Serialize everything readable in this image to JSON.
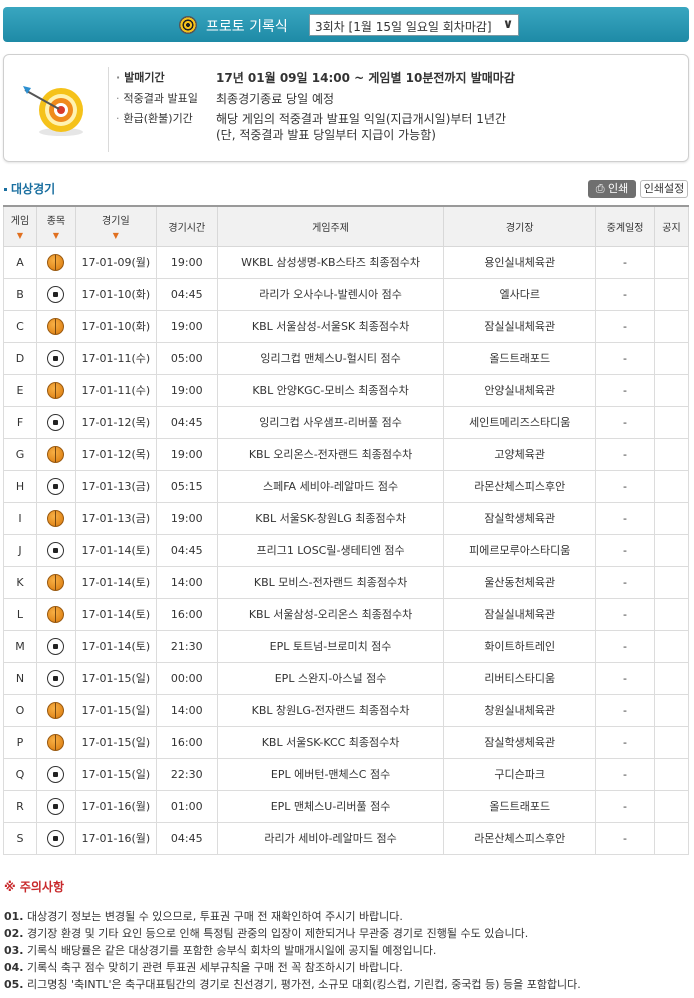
{
  "header": {
    "title": "프로토 기록식",
    "round_select_value": "3회차 [1월 15일 일요일 회차마감]"
  },
  "info": {
    "rows": [
      {
        "label": "발매기간",
        "value": "17년 01월 09일 14:00 ~ 게임별 10분전까지 발매마감"
      },
      {
        "label": "적중결과 발표일",
        "value": "최종경기종료 당일 예정"
      },
      {
        "label": "환급(환불)기간",
        "value": "해당 게임의 적중결과 발표일 익일(지급개시일)부터 1년간"
      }
    ],
    "note": "(단, 적중결과 발표 당일부터 지급이 가능함)"
  },
  "section": {
    "title": "대상경기",
    "print_label": "인쇄",
    "print_settings_label": "인쇄설정"
  },
  "table": {
    "headers": [
      "게임",
      "종목",
      "경기일",
      "경기시간",
      "게임주제",
      "경기장",
      "중계일정",
      "공지"
    ],
    "sortable": [
      true,
      true,
      true,
      false,
      false,
      false,
      false,
      false
    ],
    "rows": [
      {
        "game": "A",
        "sport": "basketball",
        "date": "17-01-09(월)",
        "time": "19:00",
        "subject": "WKBL 삼성생명-KB스타즈 최종점수차",
        "venue": "용인실내체육관",
        "broadcast": "-",
        "notice": ""
      },
      {
        "game": "B",
        "sport": "soccer",
        "date": "17-01-10(화)",
        "time": "04:45",
        "subject": "라리가 오사수나-발렌시아 점수",
        "venue": "엘사다르",
        "broadcast": "-",
        "notice": ""
      },
      {
        "game": "C",
        "sport": "basketball",
        "date": "17-01-10(화)",
        "time": "19:00",
        "subject": "KBL 서울삼성-서울SK 최종점수차",
        "venue": "잠실실내체육관",
        "broadcast": "-",
        "notice": ""
      },
      {
        "game": "D",
        "sport": "soccer",
        "date": "17-01-11(수)",
        "time": "05:00",
        "subject": "잉리그컵 맨체스U-헐시티 점수",
        "venue": "올드트래포드",
        "broadcast": "-",
        "notice": ""
      },
      {
        "game": "E",
        "sport": "basketball",
        "date": "17-01-11(수)",
        "time": "19:00",
        "subject": "KBL 안양KGC-모비스 최종점수차",
        "venue": "안양실내체육관",
        "broadcast": "-",
        "notice": ""
      },
      {
        "game": "F",
        "sport": "soccer",
        "date": "17-01-12(목)",
        "time": "04:45",
        "subject": "잉리그컵 사우샘프-리버풀 점수",
        "venue": "세인트메리즈스타디움",
        "broadcast": "-",
        "notice": ""
      },
      {
        "game": "G",
        "sport": "basketball",
        "date": "17-01-12(목)",
        "time": "19:00",
        "subject": "KBL 오리온스-전자랜드 최종점수차",
        "venue": "고양체육관",
        "broadcast": "-",
        "notice": ""
      },
      {
        "game": "H",
        "sport": "soccer",
        "date": "17-01-13(금)",
        "time": "05:15",
        "subject": "스페FA 세비야-레알마드 점수",
        "venue": "라몬산체스피스후안",
        "broadcast": "-",
        "notice": ""
      },
      {
        "game": "I",
        "sport": "basketball",
        "date": "17-01-13(금)",
        "time": "19:00",
        "subject": "KBL 서울SK-창원LG 최종점수차",
        "venue": "잠실학생체육관",
        "broadcast": "-",
        "notice": ""
      },
      {
        "game": "J",
        "sport": "soccer",
        "date": "17-01-14(토)",
        "time": "04:45",
        "subject": "프리그1 LOSC릴-생테티엔 점수",
        "venue": "피에르모루아스타디움",
        "broadcast": "-",
        "notice": ""
      },
      {
        "game": "K",
        "sport": "basketball",
        "date": "17-01-14(토)",
        "time": "14:00",
        "subject": "KBL 모비스-전자랜드 최종점수차",
        "venue": "울산동천체육관",
        "broadcast": "-",
        "notice": ""
      },
      {
        "game": "L",
        "sport": "basketball",
        "date": "17-01-14(토)",
        "time": "16:00",
        "subject": "KBL 서울삼성-오리온스 최종점수차",
        "venue": "잠실실내체육관",
        "broadcast": "-",
        "notice": ""
      },
      {
        "game": "M",
        "sport": "soccer",
        "date": "17-01-14(토)",
        "time": "21:30",
        "subject": "EPL 토트넘-브로미치 점수",
        "venue": "화이트하트레인",
        "broadcast": "-",
        "notice": ""
      },
      {
        "game": "N",
        "sport": "soccer",
        "date": "17-01-15(일)",
        "time": "00:00",
        "subject": "EPL 스완지-아스널 점수",
        "venue": "리버티스타디움",
        "broadcast": "-",
        "notice": ""
      },
      {
        "game": "O",
        "sport": "basketball",
        "date": "17-01-15(일)",
        "time": "14:00",
        "subject": "KBL 창원LG-전자랜드 최종점수차",
        "venue": "창원실내체육관",
        "broadcast": "-",
        "notice": ""
      },
      {
        "game": "P",
        "sport": "basketball",
        "date": "17-01-15(일)",
        "time": "16:00",
        "subject": "KBL 서울SK-KCC 최종점수차",
        "venue": "잠실학생체육관",
        "broadcast": "-",
        "notice": ""
      },
      {
        "game": "Q",
        "sport": "soccer",
        "date": "17-01-15(일)",
        "time": "22:30",
        "subject": "EPL 에버턴-맨체스C 점수",
        "venue": "구디슨파크",
        "broadcast": "-",
        "notice": ""
      },
      {
        "game": "R",
        "sport": "soccer",
        "date": "17-01-16(월)",
        "time": "01:00",
        "subject": "EPL 맨체스U-리버풀 점수",
        "venue": "올드트래포드",
        "broadcast": "-",
        "notice": ""
      },
      {
        "game": "S",
        "sport": "soccer",
        "date": "17-01-16(월)",
        "time": "04:45",
        "subject": "라리가 세비야-레알마드 점수",
        "venue": "라몬산체스피스후안",
        "broadcast": "-",
        "notice": ""
      }
    ]
  },
  "notice": {
    "title": "※ 주의사항",
    "items": [
      {
        "num": "01.",
        "text": "대상경기 정보는 변경될 수 있으므로, 투표권 구매 전 재확인하여 주시기 바랍니다."
      },
      {
        "num": "02.",
        "text": "경기장 환경 및 기타 요인 등으로 인해 특정팀 관중의 입장이 제한되거나 무관중 경기로 진행될 수도 있습니다."
      },
      {
        "num": "03.",
        "text": "기록식 배당률은 같은 대상경기를 포함한 승부식 회차의 발매개시일에 공지될 예정입니다."
      },
      {
        "num": "04.",
        "text": "기록식 축구 점수 맞히기 관련 투표권 세부규칙을 구매 전 꼭 참조하시기 바랍니다."
      },
      {
        "num": "05.",
        "text": "리그명칭 '축INTL'은 축구대표팀간의 경기로 친선경기, 평가전, 소규모 대회(킹스컵, 기린컵, 중국컵 등) 등을 포함합니다."
      }
    ]
  },
  "colors": {
    "header_bar": "#2a97b3",
    "section_title": "#1a6fa0",
    "notice_title": "#c8292b",
    "sort_arrow": "#e07020"
  }
}
